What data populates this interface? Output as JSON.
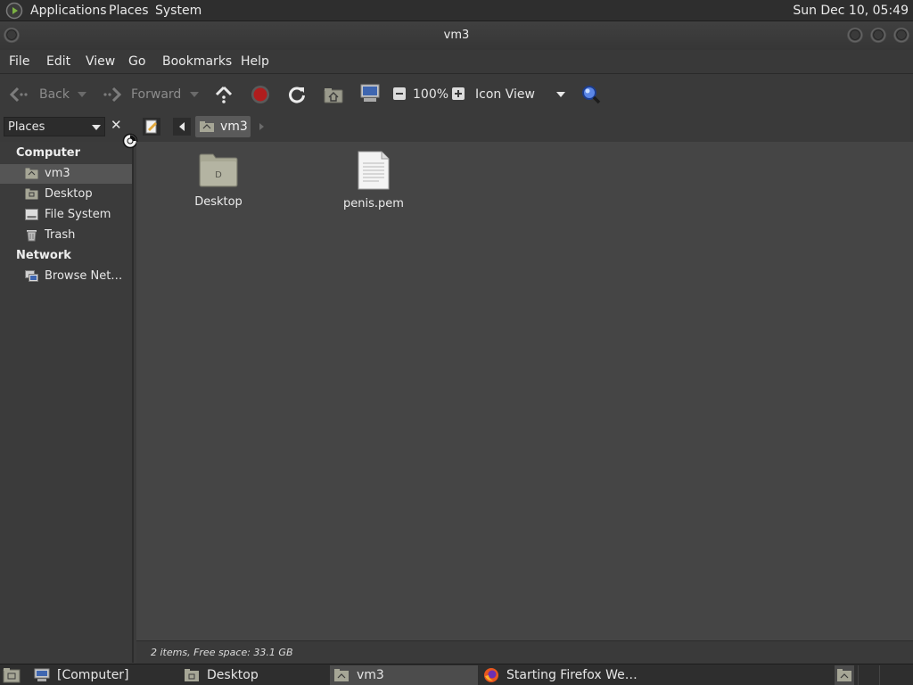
{
  "top_panel": {
    "menus": [
      "Applications",
      "Places",
      "System"
    ],
    "clock": "Sun Dec 10, 05:49"
  },
  "window": {
    "title": "vm3"
  },
  "menubar": [
    "File",
    "Edit",
    "View",
    "Go",
    "Bookmarks",
    "Help"
  ],
  "toolbar": {
    "back_label": "Back",
    "forward_label": "Forward",
    "zoom_level": "100%",
    "view_mode": "Icon View"
  },
  "location": {
    "current_folder": "vm3"
  },
  "sidebar": {
    "selector_label": "Places",
    "sections": [
      {
        "heading": "Computer",
        "items": [
          {
            "label": "vm3",
            "icon": "home-folder-icon",
            "selected": true
          },
          {
            "label": "Desktop",
            "icon": "desktop-folder-icon"
          },
          {
            "label": "File System",
            "icon": "drive-icon"
          },
          {
            "label": "Trash",
            "icon": "trash-icon"
          }
        ]
      },
      {
        "heading": "Network",
        "items": [
          {
            "label": "Browse Net…",
            "icon": "network-icon"
          }
        ]
      }
    ]
  },
  "files": [
    {
      "name": "Desktop",
      "type": "folder"
    },
    {
      "name": "penis.pem",
      "type": "document"
    }
  ],
  "status": "2 items, Free space: 33.1 GB",
  "taskbar": {
    "tasks": [
      {
        "label": "[Computer]",
        "icon": "computer-icon"
      },
      {
        "label": "Desktop",
        "icon": "folder-icon"
      },
      {
        "label": "vm3",
        "icon": "home-folder-icon",
        "active": true
      },
      {
        "label": "Starting Firefox We…",
        "icon": "firefox-icon"
      }
    ]
  },
  "colors": {
    "panel_bg": "#2e2e2e",
    "window_bg": "#3a3a3a",
    "content_bg": "#454545",
    "accent_stop": "#b01d1d",
    "search_blue": "#3d6fd8"
  }
}
